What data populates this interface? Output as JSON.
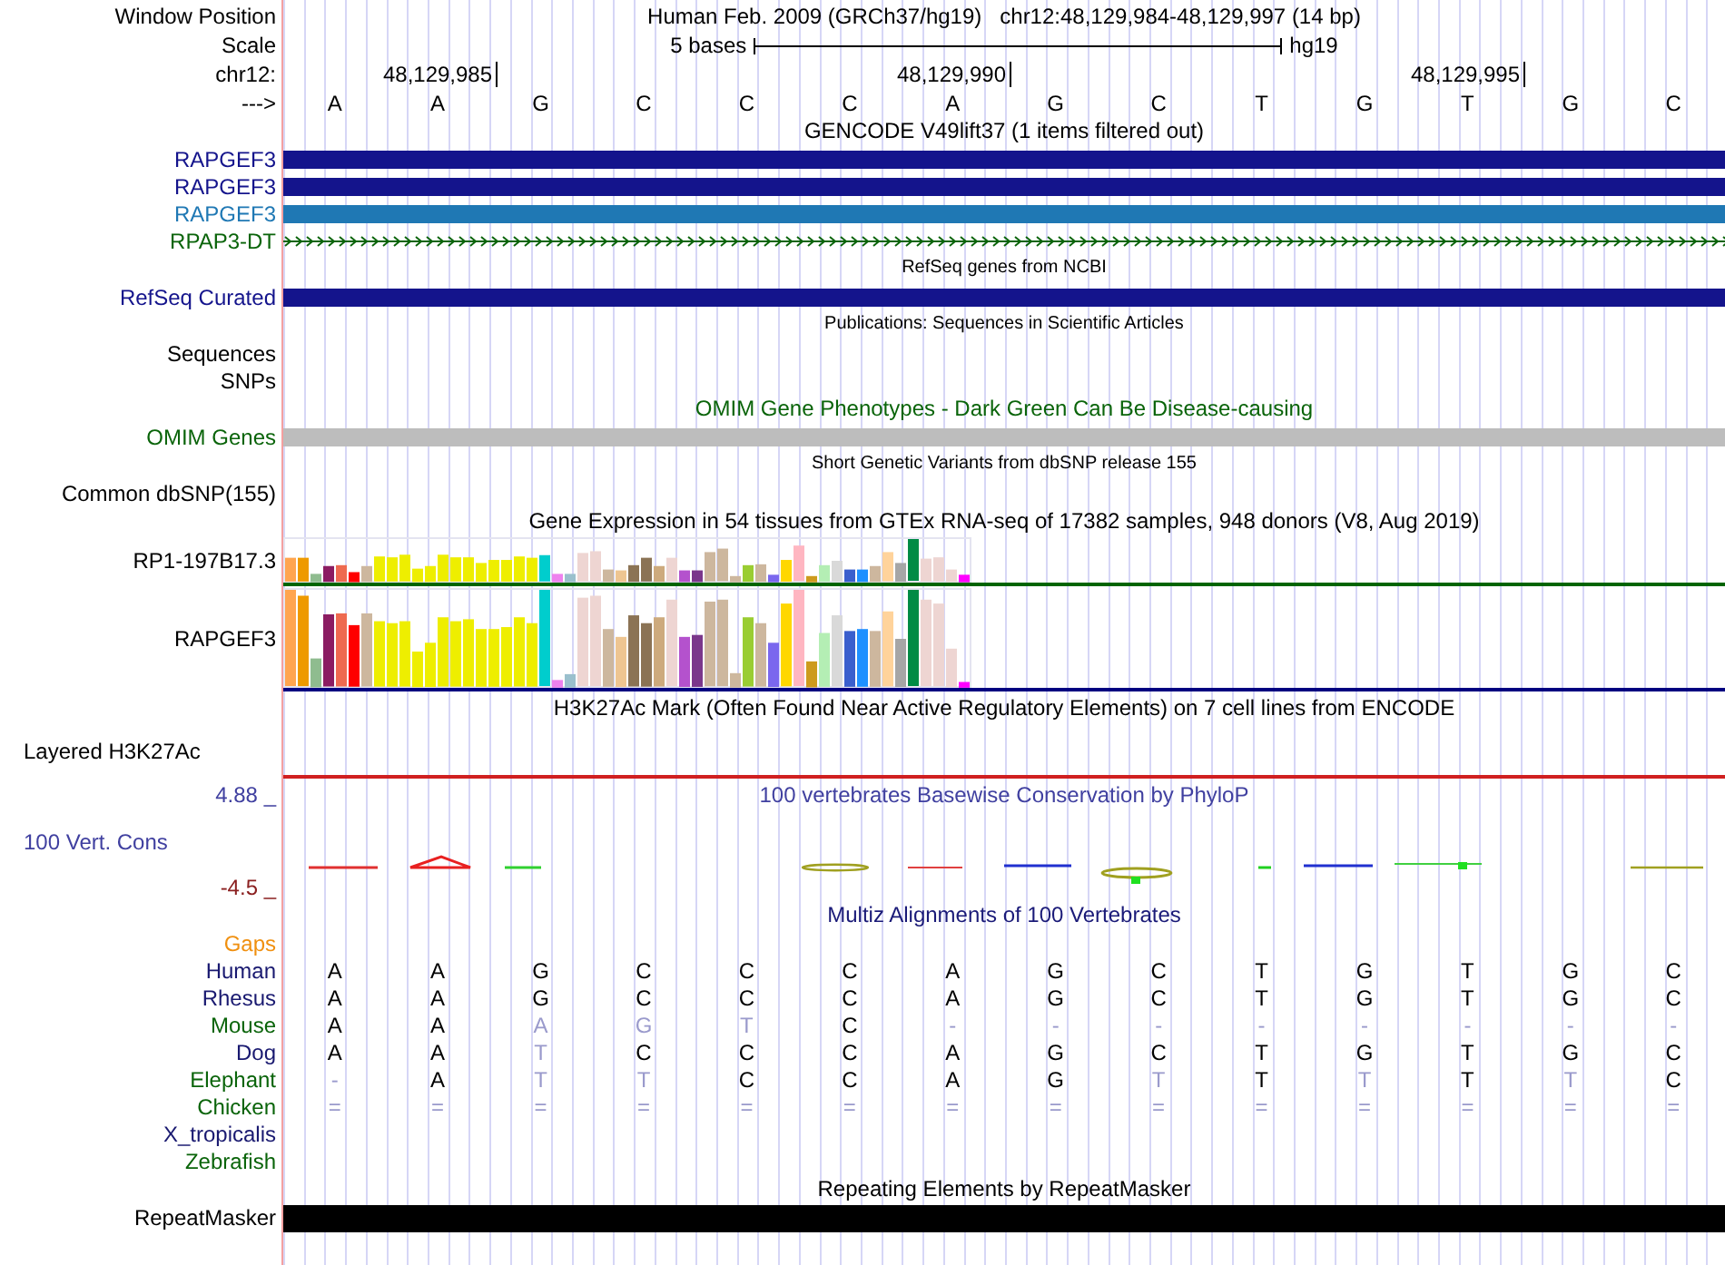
{
  "tracks": [
    {
      "kind": "position",
      "label": "Window Position",
      "assembly": "Human Feb. 2009 (GRCh37/hg19)",
      "range": "chr12:48,129,984-48,129,997 (14 bp)"
    },
    {
      "kind": "scale",
      "label": "Scale",
      "span": "5 bases",
      "db": "hg19"
    },
    {
      "kind": "coords",
      "label": "chr12:",
      "ticks": [
        "48,129,985",
        "48,129,990",
        "48,129,995"
      ]
    },
    {
      "kind": "sequence",
      "label": "--->",
      "bases": [
        "A",
        "A",
        "G",
        "C",
        "C",
        "C",
        "A",
        "G",
        "C",
        "T",
        "G",
        "T",
        "G",
        "C"
      ]
    },
    {
      "kind": "title",
      "text": "GENCODE V49lift37 (1 items filtered out)",
      "color": "#000000",
      "small": false
    },
    {
      "kind": "gene",
      "label": "RAPGEF3",
      "color": "#14148c"
    },
    {
      "kind": "gene",
      "label": "RAPGEF3",
      "color": "#14148c"
    },
    {
      "kind": "gene",
      "label": "RAPGEF3",
      "color": "#1f78b4"
    },
    {
      "kind": "arrows",
      "label": "RPAP3-DT",
      "color": "#0a640a"
    },
    {
      "kind": "title",
      "text": "RefSeq genes from NCBI",
      "color": "#000000",
      "small": true
    },
    {
      "kind": "gene",
      "label": "RefSeq Curated",
      "color": "#14148c"
    },
    {
      "kind": "title",
      "text": "Publications: Sequences in Scientific Articles",
      "color": "#000000",
      "small": true
    },
    {
      "kind": "label",
      "label": "Sequences",
      "color": "#000000"
    },
    {
      "kind": "label",
      "label": "SNPs",
      "color": "#000000"
    },
    {
      "kind": "title",
      "text": "OMIM Gene Phenotypes - Dark Green Can Be Disease-causing",
      "color": "#0a640a",
      "small": false
    },
    {
      "kind": "omim",
      "label": "OMIM Genes",
      "color": "#0a640a"
    },
    {
      "kind": "title",
      "text": "Short Genetic Variants from dbSNP release 155",
      "color": "#000000",
      "small": true
    },
    {
      "kind": "label",
      "label": "Common dbSNP(155)",
      "color": "#000000"
    },
    {
      "kind": "title",
      "text": "Gene Expression in 54 tissues from GTEx RNA-seq of 17382 samples, 948 donors (V8, Aug 2019)",
      "color": "#000000",
      "small": false
    },
    {
      "kind": "expression",
      "label": "RP1-197B17.3",
      "color": "#006400"
    },
    {
      "kind": "expression",
      "label": "RAPGEF3",
      "color": "#000080"
    },
    {
      "kind": "title",
      "text": "H3K27Ac Mark (Often Found Near Active Regulatory Elements) on 7 cell lines from ENCODE",
      "color": "#000000",
      "small": false
    },
    {
      "kind": "layered",
      "label": "Layered H3K27Ac"
    },
    {
      "kind": "wiggle",
      "label": "100 Vert. Cons",
      "max": "4.88 _",
      "min": "-4.5 _",
      "title": "100 vertebrates Basewise Conservation by PhyloP"
    },
    {
      "kind": "title",
      "text": "Multiz Alignments of 100 Vertebrates",
      "color": "#1a1a78",
      "small": false
    },
    {
      "kind": "label",
      "label": "Gaps",
      "color": "#f09010"
    },
    {
      "kind": "species",
      "label": "Human",
      "color": "#191970",
      "bases": [
        {
          "b": "A",
          "faded": false
        },
        {
          "b": "A",
          "faded": false
        },
        {
          "b": "G",
          "faded": false
        },
        {
          "b": "C",
          "faded": false
        },
        {
          "b": "C",
          "faded": false
        },
        {
          "b": "C",
          "faded": false
        },
        {
          "b": "A",
          "faded": false
        },
        {
          "b": "G",
          "faded": false
        },
        {
          "b": "C",
          "faded": false
        },
        {
          "b": "T",
          "faded": false
        },
        {
          "b": "G",
          "faded": false
        },
        {
          "b": "T",
          "faded": false
        },
        {
          "b": "G",
          "faded": false
        },
        {
          "b": "C",
          "faded": false
        }
      ]
    },
    {
      "kind": "species",
      "label": "Rhesus",
      "color": "#191970",
      "bases": [
        {
          "b": "A",
          "faded": false
        },
        {
          "b": "A",
          "faded": false
        },
        {
          "b": "G",
          "faded": false
        },
        {
          "b": "C",
          "faded": false
        },
        {
          "b": "C",
          "faded": false
        },
        {
          "b": "C",
          "faded": false
        },
        {
          "b": "A",
          "faded": false
        },
        {
          "b": "G",
          "faded": false
        },
        {
          "b": "C",
          "faded": false
        },
        {
          "b": "T",
          "faded": false
        },
        {
          "b": "G",
          "faded": false
        },
        {
          "b": "T",
          "faded": false
        },
        {
          "b": "G",
          "faded": false
        },
        {
          "b": "C",
          "faded": false
        }
      ]
    },
    {
      "kind": "species",
      "label": "Mouse",
      "color": "#0a640a",
      "bases": [
        {
          "b": "A",
          "faded": false
        },
        {
          "b": "A",
          "faded": false
        },
        {
          "b": "A",
          "faded": true
        },
        {
          "b": "G",
          "faded": true
        },
        {
          "b": "T",
          "faded": true
        },
        {
          "b": "C",
          "faded": false
        },
        {
          "b": "-",
          "faded": true
        },
        {
          "b": "-",
          "faded": true
        },
        {
          "b": "-",
          "faded": true
        },
        {
          "b": "-",
          "faded": true
        },
        {
          "b": "-",
          "faded": true
        },
        {
          "b": "-",
          "faded": true
        },
        {
          "b": "-",
          "faded": true
        },
        {
          "b": "-",
          "faded": true
        }
      ]
    },
    {
      "kind": "species",
      "label": "Dog",
      "color": "#191970",
      "bases": [
        {
          "b": "A",
          "faded": false
        },
        {
          "b": "A",
          "faded": false
        },
        {
          "b": "T",
          "faded": true
        },
        {
          "b": "C",
          "faded": false
        },
        {
          "b": "C",
          "faded": false
        },
        {
          "b": "C",
          "faded": false
        },
        {
          "b": "A",
          "faded": false
        },
        {
          "b": "G",
          "faded": false
        },
        {
          "b": "C",
          "faded": false
        },
        {
          "b": "T",
          "faded": false
        },
        {
          "b": "G",
          "faded": false
        },
        {
          "b": "T",
          "faded": false
        },
        {
          "b": "G",
          "faded": false
        },
        {
          "b": "C",
          "faded": false
        }
      ]
    },
    {
      "kind": "species",
      "label": "Elephant",
      "color": "#0a640a",
      "bases": [
        {
          "b": "-",
          "faded": true
        },
        {
          "b": "A",
          "faded": false
        },
        {
          "b": "T",
          "faded": true
        },
        {
          "b": "T",
          "faded": true
        },
        {
          "b": "C",
          "faded": false
        },
        {
          "b": "C",
          "faded": false
        },
        {
          "b": "A",
          "faded": false
        },
        {
          "b": "G",
          "faded": false
        },
        {
          "b": "T",
          "faded": true
        },
        {
          "b": "T",
          "faded": false
        },
        {
          "b": "T",
          "faded": true
        },
        {
          "b": "T",
          "faded": false
        },
        {
          "b": "T",
          "faded": true
        },
        {
          "b": "C",
          "faded": false
        }
      ]
    },
    {
      "kind": "species",
      "label": "Chicken",
      "color": "#0a640a",
      "bases": [
        {
          "b": "=",
          "faded": true
        },
        {
          "b": "=",
          "faded": true
        },
        {
          "b": "=",
          "faded": true
        },
        {
          "b": "=",
          "faded": true
        },
        {
          "b": "=",
          "faded": true
        },
        {
          "b": "=",
          "faded": true
        },
        {
          "b": "=",
          "faded": true
        },
        {
          "b": "=",
          "faded": true
        },
        {
          "b": "=",
          "faded": true
        },
        {
          "b": "=",
          "faded": true
        },
        {
          "b": "=",
          "faded": true
        },
        {
          "b": "=",
          "faded": true
        },
        {
          "b": "=",
          "faded": true
        },
        {
          "b": "=",
          "faded": true
        }
      ]
    },
    {
      "kind": "species",
      "label": "X_tropicalis",
      "color": "#191970"
    },
    {
      "kind": "species",
      "label": "Zebrafish",
      "color": "#0a640a"
    },
    {
      "kind": "title",
      "text": "Repeating Elements by RepeatMasker",
      "color": "#000000",
      "small": false
    },
    {
      "kind": "repeat",
      "label": "RepeatMasker"
    }
  ]
}
